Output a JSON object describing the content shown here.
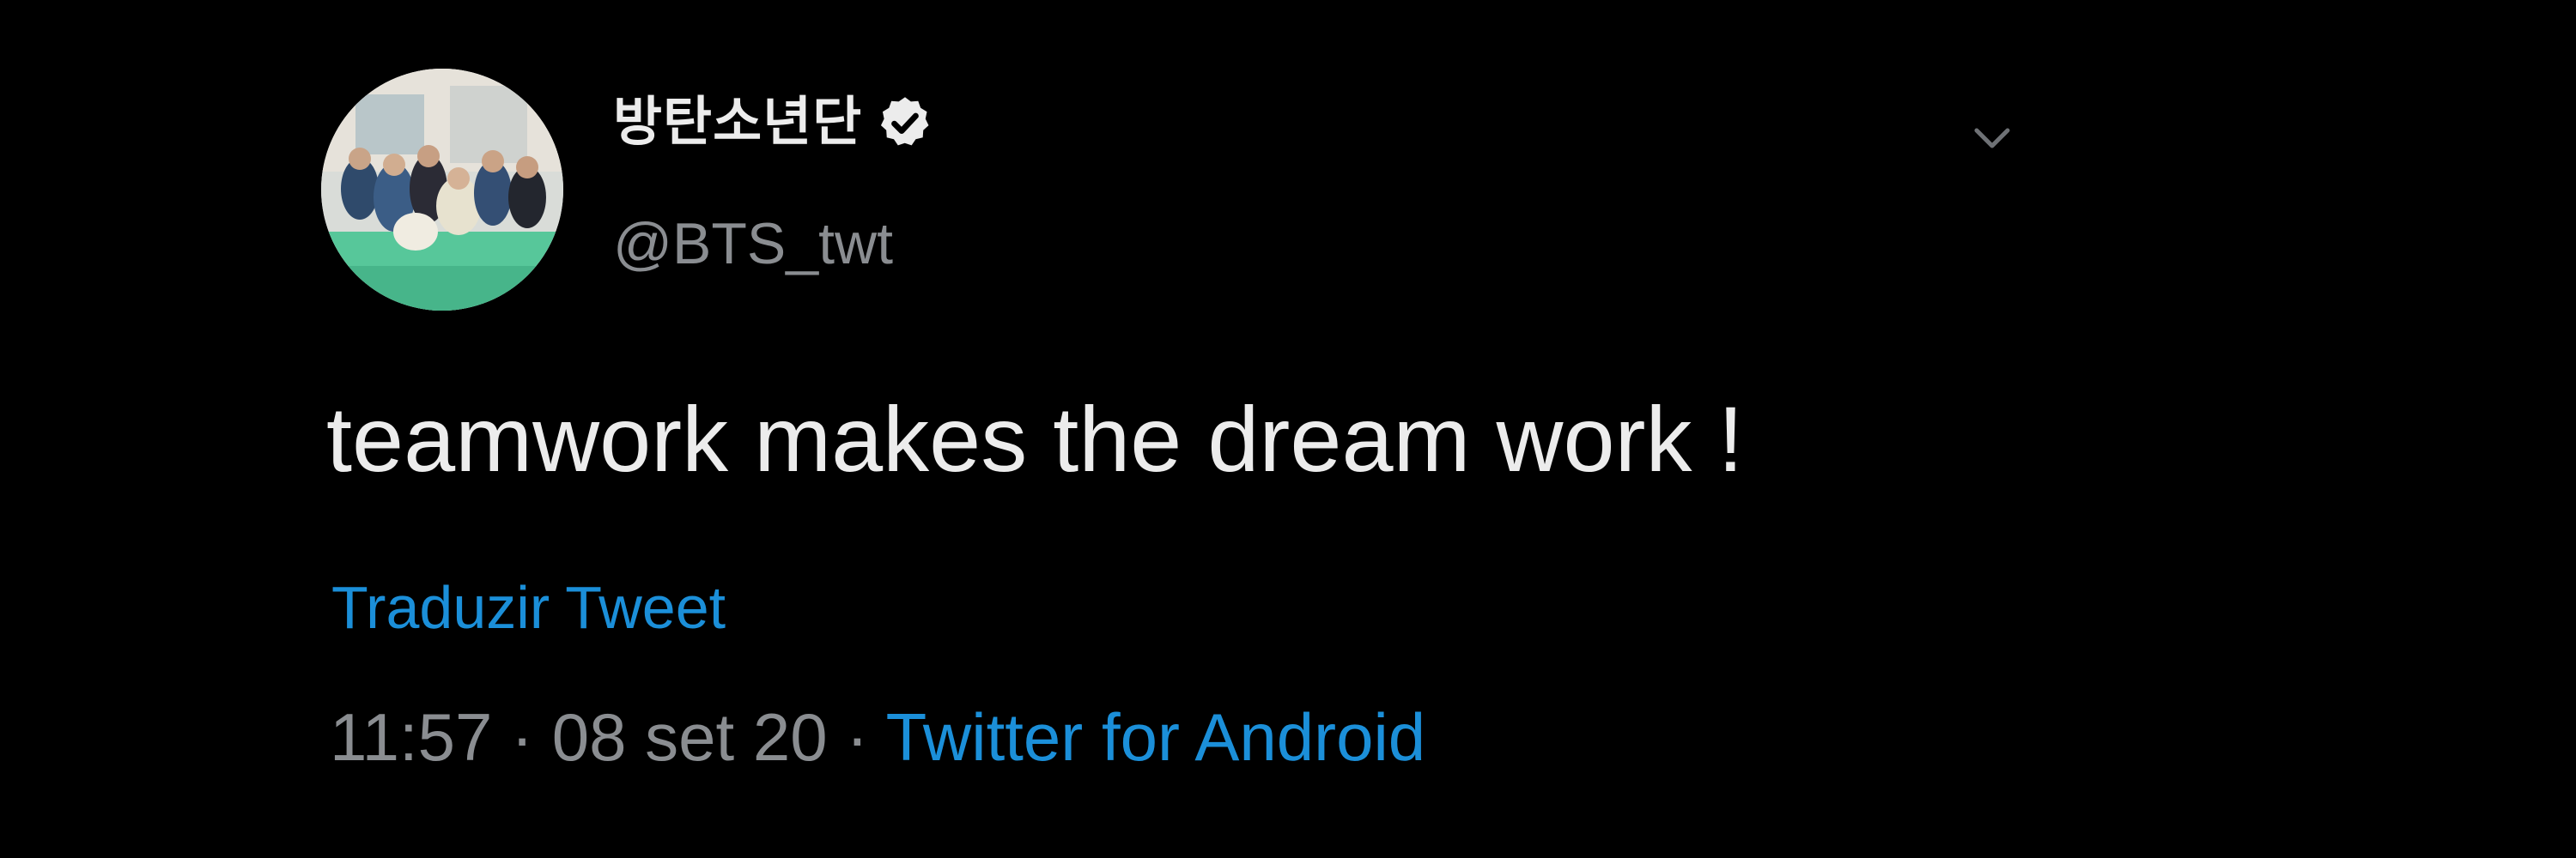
{
  "tweet": {
    "display_name": "방탄소년단",
    "handle": "@BTS_twt",
    "verified": true,
    "text": "teamwork makes the dream work !",
    "translate_label": "Traduzir Tweet",
    "time": "11:57",
    "separator": "·",
    "date": "08 set 20",
    "source": "Twitter for Android"
  },
  "icons": {
    "avatar": "group-photo-avatar",
    "verified": "verified-badge-icon",
    "menu": "chevron-down-icon"
  },
  "colors": {
    "background": "#000000",
    "primary_text": "#ececec",
    "secondary_text": "#8a8d91",
    "link": "#1b8fd9"
  }
}
